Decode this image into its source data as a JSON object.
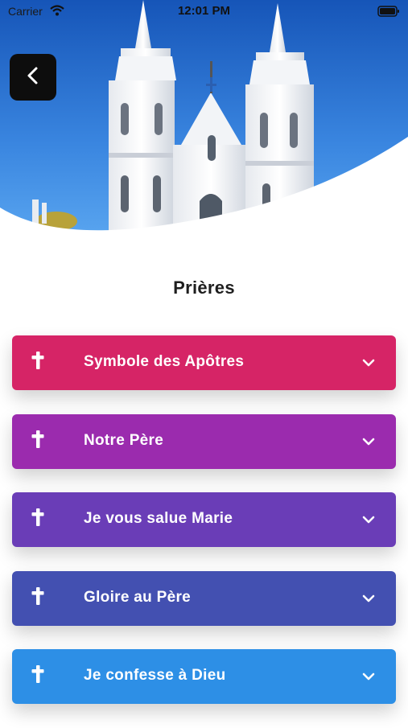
{
  "status_bar": {
    "carrier": "Carrier",
    "time": "12:01 PM"
  },
  "header": {
    "image_icon": "church-image",
    "back_icon": "chevron-left-icon"
  },
  "page": {
    "title": "Prières"
  },
  "prayers": [
    {
      "label": "Symbole des Apôtres",
      "color": "#d62466"
    },
    {
      "label": "Notre Père",
      "color": "#9b2bae"
    },
    {
      "label": "Je vous salue Marie",
      "color": "#6a3db7"
    },
    {
      "label": "Gloire au Père",
      "color": "#4350b1"
    },
    {
      "label": "Je confesse à Dieu",
      "color": "#2d8fe6"
    }
  ],
  "icons": {
    "item_leading": "cross-icon",
    "item_trailing": "chevron-down-icon"
  }
}
